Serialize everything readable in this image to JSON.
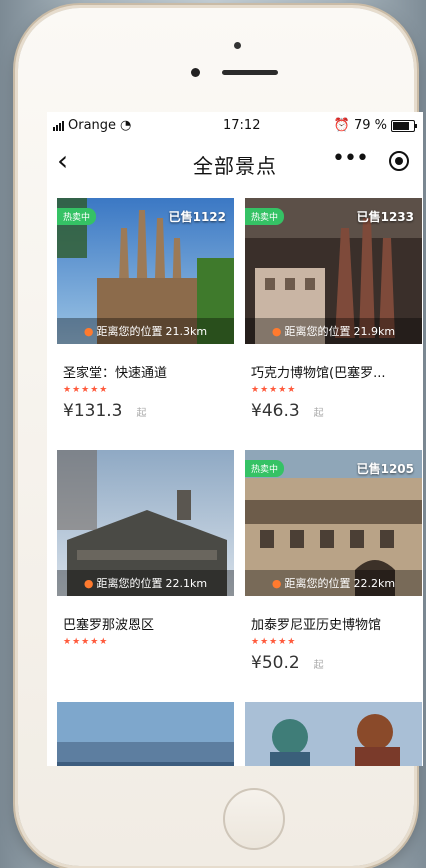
{
  "status": {
    "carrier": "Orange",
    "time": "17:12",
    "battery": "79 %",
    "battery_level": 0.79
  },
  "header": {
    "back_icon": "‹",
    "title": "全部景点",
    "more_icon": "•••",
    "target_icon": "target"
  },
  "labels": {
    "distance_prefix": "距离您的位置",
    "currency": "¥",
    "price_suffix": "起",
    "hot_tag": "热卖中"
  },
  "cards": [
    {
      "name": "圣家堂：快速通道",
      "sold": "已售1122",
      "distance": "21.3km",
      "stars": "★★★★★",
      "price": "¥131.3",
      "from": "起",
      "hot": true,
      "theme": "sagrada"
    },
    {
      "name": "巧克力博物馆(巴塞罗...",
      "sold": "已售1233",
      "distance": "21.9km",
      "stars": "★★★★★",
      "price": "¥46.3",
      "from": "起",
      "hot": true,
      "theme": "chocolate"
    },
    {
      "name": "巴塞罗那波恩区",
      "sold": "",
      "distance": "22.1km",
      "stars": "★★★★★",
      "price": "",
      "from": "",
      "hot": false,
      "theme": "born"
    },
    {
      "name": "加泰罗尼亚历史博物馆",
      "sold": "已售1205",
      "distance": "22.2km",
      "stars": "★★★★★",
      "price": "¥50.2",
      "from": "起",
      "hot": true,
      "theme": "museum"
    }
  ]
}
